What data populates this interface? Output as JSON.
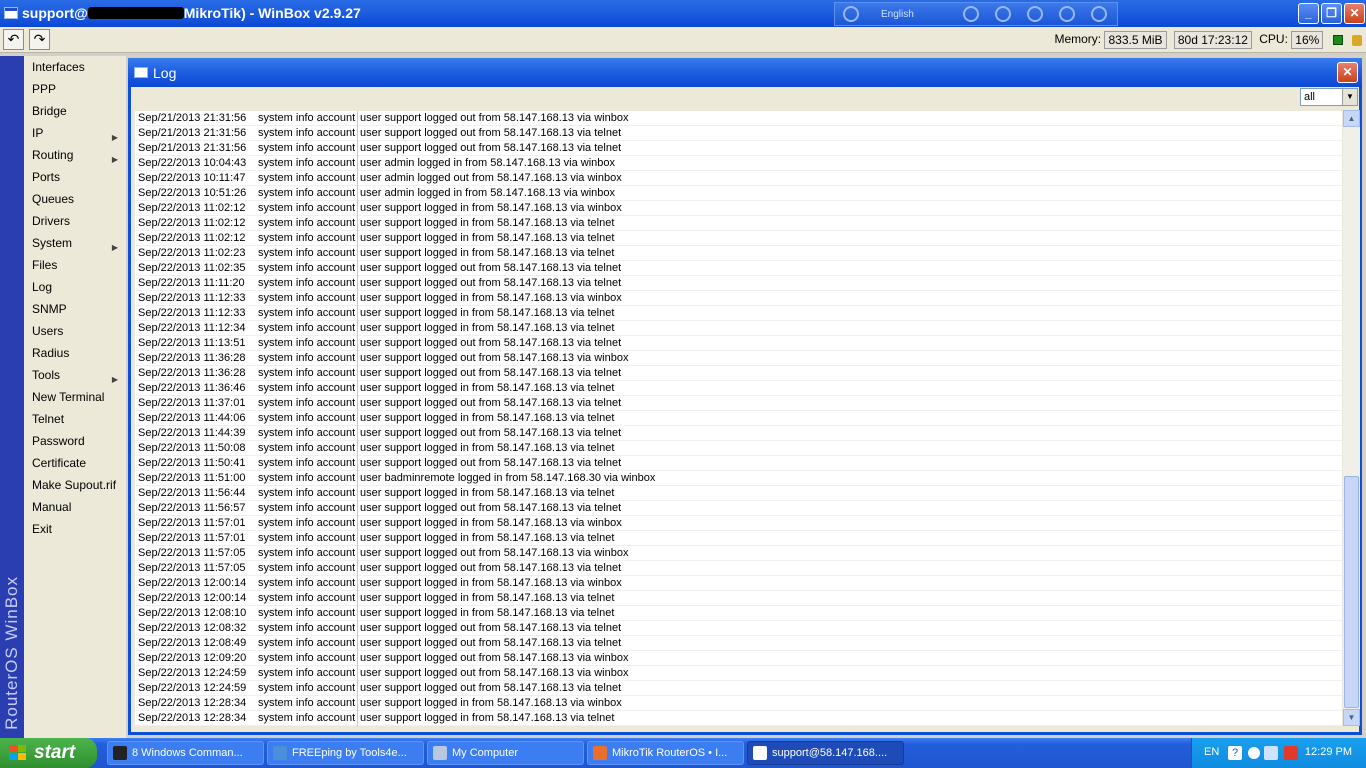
{
  "window": {
    "title_prefix": "support@",
    "title_suffix": "MikroTik) - WinBox v2.9.27",
    "language": "English"
  },
  "toolbar": {
    "undo_label": "↶",
    "redo_label": "↷",
    "memory_label": "Memory:",
    "memory_value": "833.5 MiB",
    "uptime": "80d 17:23:12",
    "cpu_label": "CPU:",
    "cpu_value": "16%"
  },
  "sidebar": {
    "brand": "RouterOS WinBox",
    "items": [
      {
        "label": "Interfaces",
        "submenu": false
      },
      {
        "label": "PPP",
        "submenu": false
      },
      {
        "label": "Bridge",
        "submenu": false
      },
      {
        "label": "IP",
        "submenu": true
      },
      {
        "label": "Routing",
        "submenu": true
      },
      {
        "label": "Ports",
        "submenu": false
      },
      {
        "label": "Queues",
        "submenu": false
      },
      {
        "label": "Drivers",
        "submenu": false
      },
      {
        "label": "System",
        "submenu": true
      },
      {
        "label": "Files",
        "submenu": false
      },
      {
        "label": "Log",
        "submenu": false
      },
      {
        "label": "SNMP",
        "submenu": false
      },
      {
        "label": "Users",
        "submenu": false
      },
      {
        "label": "Radius",
        "submenu": false
      },
      {
        "label": "Tools",
        "submenu": true
      },
      {
        "label": "New Terminal",
        "submenu": false
      },
      {
        "label": "Telnet",
        "submenu": false
      },
      {
        "label": "Password",
        "submenu": false
      },
      {
        "label": "Certificate",
        "submenu": false
      },
      {
        "label": "Make Supout.rif",
        "submenu": false
      },
      {
        "label": "Manual",
        "submenu": false
      },
      {
        "label": "Exit",
        "submenu": false
      }
    ]
  },
  "log_window": {
    "title": "Log",
    "filter_value": "all",
    "rows": [
      {
        "time": "Sep/21/2013 21:31:56",
        "topics": "system info account",
        "message": "user support logged out from 58.147.168.13 via winbox"
      },
      {
        "time": "Sep/21/2013 21:31:56",
        "topics": "system info account",
        "message": "user support logged out from 58.147.168.13 via telnet"
      },
      {
        "time": "Sep/21/2013 21:31:56",
        "topics": "system info account",
        "message": "user support logged out from 58.147.168.13 via telnet"
      },
      {
        "time": "Sep/22/2013 10:04:43",
        "topics": "system info account",
        "message": "user admin logged in from 58.147.168.13 via winbox"
      },
      {
        "time": "Sep/22/2013 10:11:47",
        "topics": "system info account",
        "message": "user admin logged out from 58.147.168.13 via winbox"
      },
      {
        "time": "Sep/22/2013 10:51:26",
        "topics": "system info account",
        "message": "user admin logged in from 58.147.168.13 via winbox"
      },
      {
        "time": "Sep/22/2013 11:02:12",
        "topics": "system info account",
        "message": "user support logged in from 58.147.168.13 via winbox"
      },
      {
        "time": "Sep/22/2013 11:02:12",
        "topics": "system info account",
        "message": "user support logged in from 58.147.168.13 via telnet"
      },
      {
        "time": "Sep/22/2013 11:02:12",
        "topics": "system info account",
        "message": "user support logged in from 58.147.168.13 via telnet"
      },
      {
        "time": "Sep/22/2013 11:02:23",
        "topics": "system info account",
        "message": "user support logged in from 58.147.168.13 via telnet"
      },
      {
        "time": "Sep/22/2013 11:02:35",
        "topics": "system info account",
        "message": "user support logged out from 58.147.168.13 via telnet"
      },
      {
        "time": "Sep/22/2013 11:11:20",
        "topics": "system info account",
        "message": "user support logged out from 58.147.168.13 via telnet"
      },
      {
        "time": "Sep/22/2013 11:12:33",
        "topics": "system info account",
        "message": "user support logged in from 58.147.168.13 via winbox"
      },
      {
        "time": "Sep/22/2013 11:12:33",
        "topics": "system info account",
        "message": "user support logged in from 58.147.168.13 via telnet"
      },
      {
        "time": "Sep/22/2013 11:12:34",
        "topics": "system info account",
        "message": "user support logged in from 58.147.168.13 via telnet"
      },
      {
        "time": "Sep/22/2013 11:13:51",
        "topics": "system info account",
        "message": "user support logged out from 58.147.168.13 via telnet"
      },
      {
        "time": "Sep/22/2013 11:36:28",
        "topics": "system info account",
        "message": "user support logged out from 58.147.168.13 via winbox"
      },
      {
        "time": "Sep/22/2013 11:36:28",
        "topics": "system info account",
        "message": "user support logged out from 58.147.168.13 via telnet"
      },
      {
        "time": "Sep/22/2013 11:36:46",
        "topics": "system info account",
        "message": "user support logged in from 58.147.168.13 via telnet"
      },
      {
        "time": "Sep/22/2013 11:37:01",
        "topics": "system info account",
        "message": "user support logged out from 58.147.168.13 via telnet"
      },
      {
        "time": "Sep/22/2013 11:44:06",
        "topics": "system info account",
        "message": "user support logged in from 58.147.168.13 via telnet"
      },
      {
        "time": "Sep/22/2013 11:44:39",
        "topics": "system info account",
        "message": "user support logged out from 58.147.168.13 via telnet"
      },
      {
        "time": "Sep/22/2013 11:50:08",
        "topics": "system info account",
        "message": "user support logged in from 58.147.168.13 via telnet"
      },
      {
        "time": "Sep/22/2013 11:50:41",
        "topics": "system info account",
        "message": "user support logged out from 58.147.168.13 via telnet"
      },
      {
        "time": "Sep/22/2013 11:51:00",
        "topics": "system info account",
        "message": "user badminremote logged in from 58.147.168.30 via winbox"
      },
      {
        "time": "Sep/22/2013 11:56:44",
        "topics": "system info account",
        "message": "user support logged in from 58.147.168.13 via telnet"
      },
      {
        "time": "Sep/22/2013 11:56:57",
        "topics": "system info account",
        "message": "user support logged out from 58.147.168.13 via telnet"
      },
      {
        "time": "Sep/22/2013 11:57:01",
        "topics": "system info account",
        "message": "user support logged in from 58.147.168.13 via winbox"
      },
      {
        "time": "Sep/22/2013 11:57:01",
        "topics": "system info account",
        "message": "user support logged in from 58.147.168.13 via telnet"
      },
      {
        "time": "Sep/22/2013 11:57:05",
        "topics": "system info account",
        "message": "user support logged out from 58.147.168.13 via winbox"
      },
      {
        "time": "Sep/22/2013 11:57:05",
        "topics": "system info account",
        "message": "user support logged out from 58.147.168.13 via telnet"
      },
      {
        "time": "Sep/22/2013 12:00:14",
        "topics": "system info account",
        "message": "user support logged in from 58.147.168.13 via winbox"
      },
      {
        "time": "Sep/22/2013 12:00:14",
        "topics": "system info account",
        "message": "user support logged in from 58.147.168.13 via telnet"
      },
      {
        "time": "Sep/22/2013 12:08:10",
        "topics": "system info account",
        "message": "user support logged in from 58.147.168.13 via telnet"
      },
      {
        "time": "Sep/22/2013 12:08:32",
        "topics": "system info account",
        "message": "user support logged out from 58.147.168.13 via telnet"
      },
      {
        "time": "Sep/22/2013 12:08:49",
        "topics": "system info account",
        "message": "user support logged out from 58.147.168.13 via telnet"
      },
      {
        "time": "Sep/22/2013 12:09:20",
        "topics": "system info account",
        "message": "user support logged out from 58.147.168.13 via winbox"
      },
      {
        "time": "Sep/22/2013 12:24:59",
        "topics": "system info account",
        "message": "user support logged out from 58.147.168.13 via winbox"
      },
      {
        "time": "Sep/22/2013 12:24:59",
        "topics": "system info account",
        "message": "user support logged out from 58.147.168.13 via telnet"
      },
      {
        "time": "Sep/22/2013 12:28:34",
        "topics": "system info account",
        "message": "user support logged in from 58.147.168.13 via winbox"
      },
      {
        "time": "Sep/22/2013 12:28:34",
        "topics": "system info account",
        "message": "user support logged in from 58.147.168.13 via telnet"
      }
    ]
  },
  "taskbar": {
    "start_label": "start",
    "tasks": [
      {
        "label": "8 Windows Comman...",
        "icon_color": "#222222",
        "active": false
      },
      {
        "label": "FREEping by Tools4e...",
        "icon_color": "#4a8fd8",
        "active": false
      },
      {
        "label": "My Computer",
        "icon_color": "#b8c8e0",
        "active": false
      },
      {
        "label": "MikroTik RouterOS • I...",
        "icon_color": "#e8702a",
        "active": false
      },
      {
        "label": "support@58.147.168....",
        "icon_color": "#ffffff",
        "active": true
      }
    ],
    "tray_language": "EN",
    "clock": "12:29 PM"
  }
}
